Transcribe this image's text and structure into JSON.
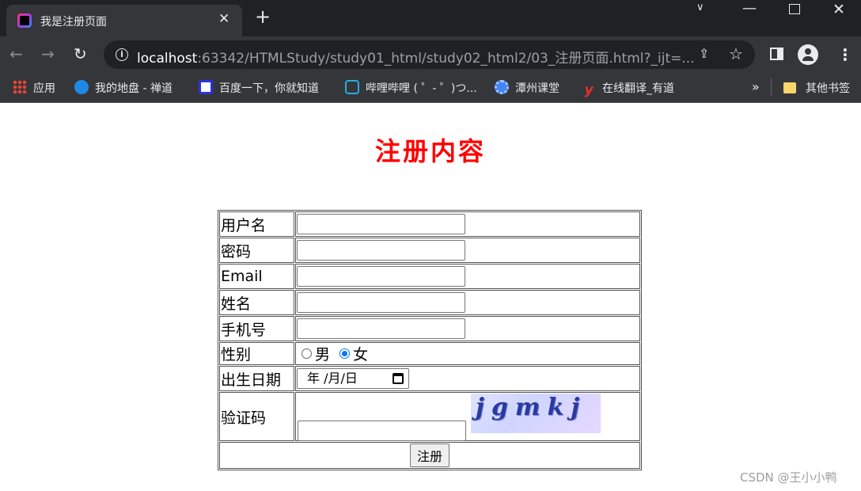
{
  "browser": {
    "tab": {
      "title": "我是注册页面"
    },
    "url": {
      "host": "localhost",
      "rest": ":63342/HTMLStudy/study01_html/study02_html2/03_注册页面.html?_ijt=..."
    },
    "bookmarks": [
      {
        "label": "应用",
        "icon": "apps-grid-icon"
      },
      {
        "label": "我的地盘 - 禅道",
        "icon": "zentao-icon"
      },
      {
        "label": "百度一下，你就知道",
        "icon": "baidu-paw-icon"
      },
      {
        "label": "哔哩哔哩 ( ゜- ゜)つ...",
        "icon": "bilibili-tv-icon"
      },
      {
        "label": "潭州课堂",
        "icon": "gear-icon"
      },
      {
        "label": "在线翻译_有道",
        "icon": "youdao-icon"
      }
    ],
    "bookmarks_more": "»",
    "other_bookmarks": "其他书签"
  },
  "page": {
    "heading": "注册内容",
    "form": {
      "username_label": "用户名",
      "password_label": "密码",
      "email_label": "Email",
      "name_label": "姓名",
      "phone_label": "手机号",
      "gender_label": "性别",
      "gender_options": [
        "男",
        "女"
      ],
      "gender_selected": "女",
      "birthday_label": "出生日期",
      "birthday_placeholder": "年 /月/日",
      "captcha_label": "验证码",
      "captcha_image_text": "jgmkj",
      "submit_label": "注册"
    }
  },
  "watermark": "CSDN @王小小鸭",
  "colors": {
    "heading": "#ff0000",
    "radio_checked": "#0075ff",
    "chrome_dark": "#202124",
    "chrome_mid": "#35363a"
  }
}
